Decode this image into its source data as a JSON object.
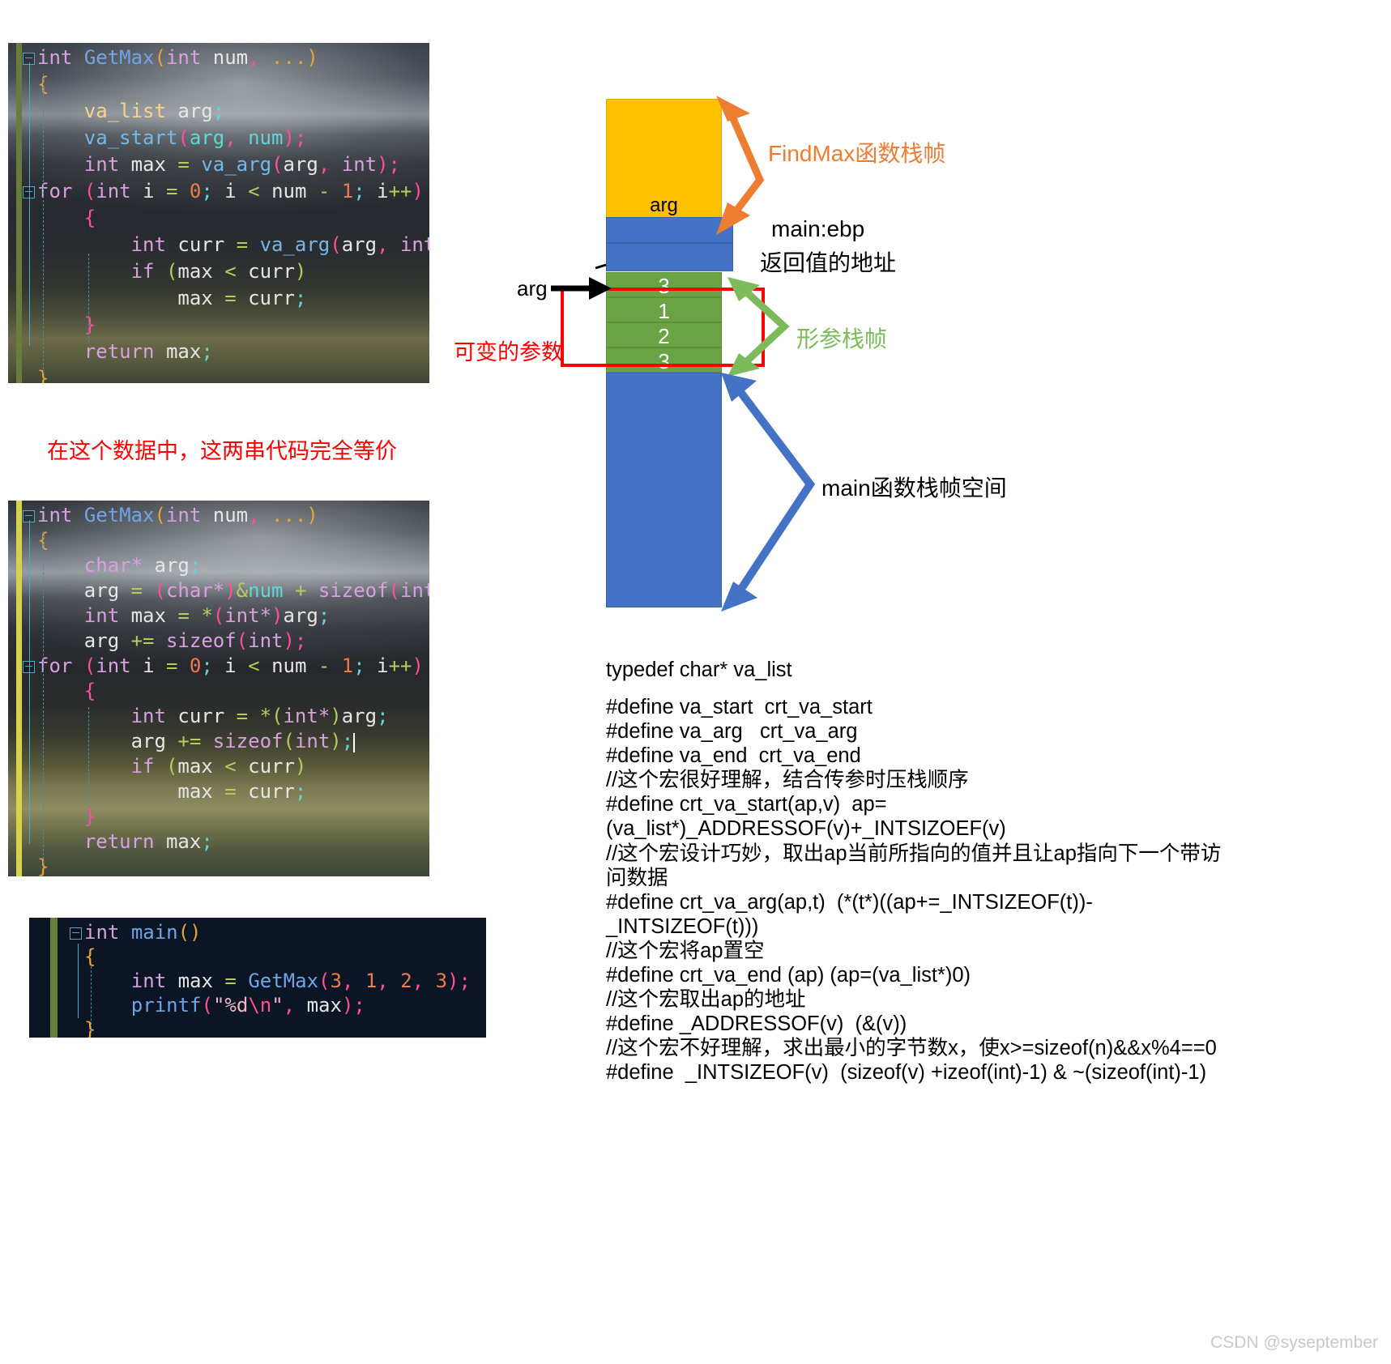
{
  "code_panel_1": {
    "name": "GetMax va_list version",
    "lines": [
      "int GetMax(int num, ...)",
      "{",
      "    va_list arg;",
      "    va_start(arg, num);",
      "    int max = va_arg(arg, int);",
      "    for (int i = 0; i < num - 1; i++)",
      "    {",
      "        int curr = va_arg(arg, int);",
      "        if (max < curr)",
      "            max = curr;",
      "    }",
      "    return max;",
      "}"
    ]
  },
  "code_panel_2": {
    "name": "GetMax pointer version",
    "lines": [
      "int GetMax(int num, ...)",
      "{",
      "    char* arg;",
      "    arg = (char*)&num + sizeof(int);",
      "    int max = *(int*)arg;",
      "    arg += sizeof(int);",
      "    for (int i = 0; i < num - 1; i++)",
      "    {",
      "        int curr = *(int*)arg;",
      "        arg += sizeof(int);",
      "        if (max < curr)",
      "            max = curr;",
      "    }",
      "    return max;",
      "}"
    ]
  },
  "code_panel_3": {
    "name": "main function",
    "lines": [
      "int main()",
      "{",
      "    int max = GetMax(3, 1, 2, 3);",
      "    printf(\"%d\\n\", max);",
      "}"
    ]
  },
  "captions": {
    "equivalent_note": "在这个数据中，这两串代码完全等价"
  },
  "diagram": {
    "findmax_frame_label": "FindMax函数栈帧",
    "arg_cell_label": "arg",
    "main_ebp_label": "main:ebp",
    "return_addr_label": "返回值的地址",
    "arg_pointer_label": "arg",
    "variadic_args_label": "可变的参数",
    "params_frame_label": "形参栈帧",
    "main_frame_label": "main函数栈帧空间",
    "param_values": [
      "3",
      "1",
      "2",
      "3"
    ],
    "colors": {
      "orange": "#ffc000",
      "blue": "#4472c4",
      "green": "#6aa344",
      "red": "#ff0000",
      "orange_arrow": "#ed7d31",
      "green_arrow": "#7cbb5c",
      "blue_arrow": "#4472c4"
    }
  },
  "macros": {
    "lines": [
      "typedef char* va_list",
      "",
      "#define va_start  crt_va_start",
      "#define va_arg   crt_va_arg",
      "#define va_end  crt_va_end",
      "//这个宏很好理解，结合传参时压栈顺序",
      "#define crt_va_start(ap,v)  ap=(va_list*)_ADDRESSOF(v)+_INTSIZOEF(v)",
      "//这个宏设计巧妙，取出ap当前所指向的值并且让ap指向下一个带访问数据",
      "#define crt_va_arg(ap,t)  (*(t*)((ap+=_INTSIZEOF(t))-_INTSIZEOF(t)))",
      "//这个宏将ap置空",
      "#define crt_va_end (ap) (ap=(va_list*)0)",
      "//这个宏取出ap的地址",
      "#define _ADDRESSOF(v)  (&(v))",
      "//这个宏不好理解，求出最小的字节数x，使x>=sizeof(n)&&x%4==0",
      "#define  _INTSIZEOF(v)  (sizeof(v) +izeof(int)-1) & ~(sizeof(int)-1)"
    ]
  },
  "watermark": {
    "text": "CSDN @syseptember"
  }
}
